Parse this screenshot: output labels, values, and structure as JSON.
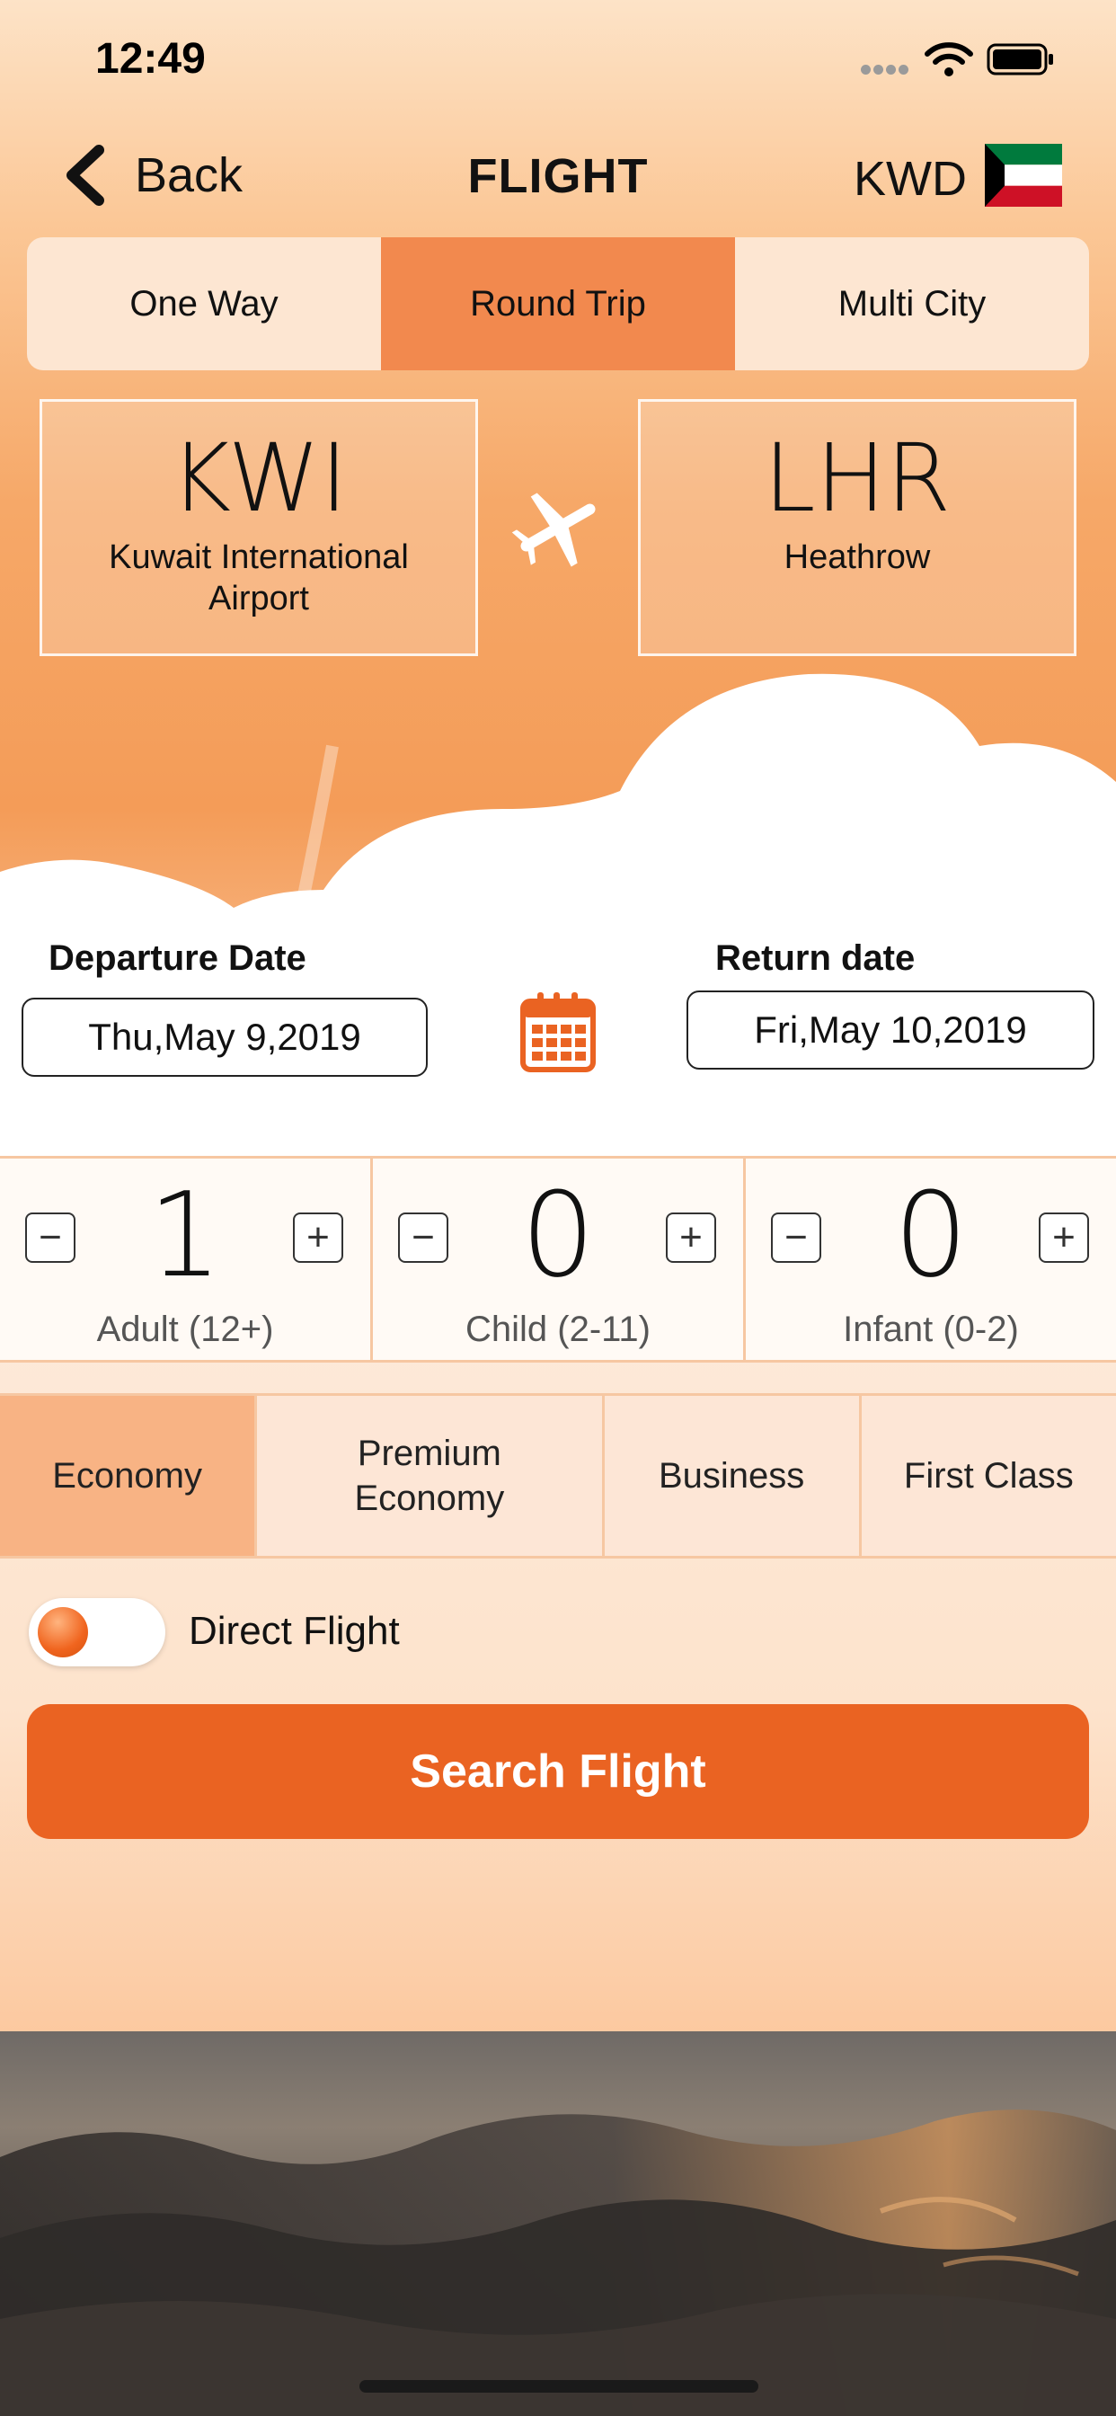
{
  "status_bar": {
    "time": "12:49"
  },
  "nav": {
    "back_label": "Back",
    "title": "FLIGHT",
    "currency": "KWD"
  },
  "trip_tabs": [
    {
      "label": "One Way",
      "active": false
    },
    {
      "label": "Round Trip",
      "active": true
    },
    {
      "label": "Multi City",
      "active": false
    }
  ],
  "route": {
    "from": {
      "code": "KWI",
      "name": "Kuwait International Airport"
    },
    "to": {
      "code": "LHR",
      "name": "Heathrow"
    }
  },
  "dates": {
    "departure_label": "Departure Date",
    "departure_value": "Thu,May 9,2019",
    "return_label": "Return date",
    "return_value": "Fri,May 10,2019"
  },
  "passengers": [
    {
      "count": "1",
      "label": "Adult (12+)"
    },
    {
      "count": "0",
      "label": "Child (2-11)"
    },
    {
      "count": "0",
      "label": "Infant (0-2)"
    }
  ],
  "stepper": {
    "minus": "−",
    "plus": "+"
  },
  "cabin_classes": [
    {
      "label": "Economy",
      "active": true
    },
    {
      "label": "Premium Economy",
      "active": false
    },
    {
      "label": "Business",
      "active": false
    },
    {
      "label": "First Class",
      "active": false
    }
  ],
  "direct_flight": {
    "label": "Direct Flight",
    "enabled": true
  },
  "search_button": {
    "label": "Search Flight"
  },
  "colors": {
    "accent": "#ea6322",
    "tab_active": "#f2894e",
    "cabin_active": "#f8b384",
    "flag_green": "#007a3d",
    "flag_red": "#ce1126"
  }
}
